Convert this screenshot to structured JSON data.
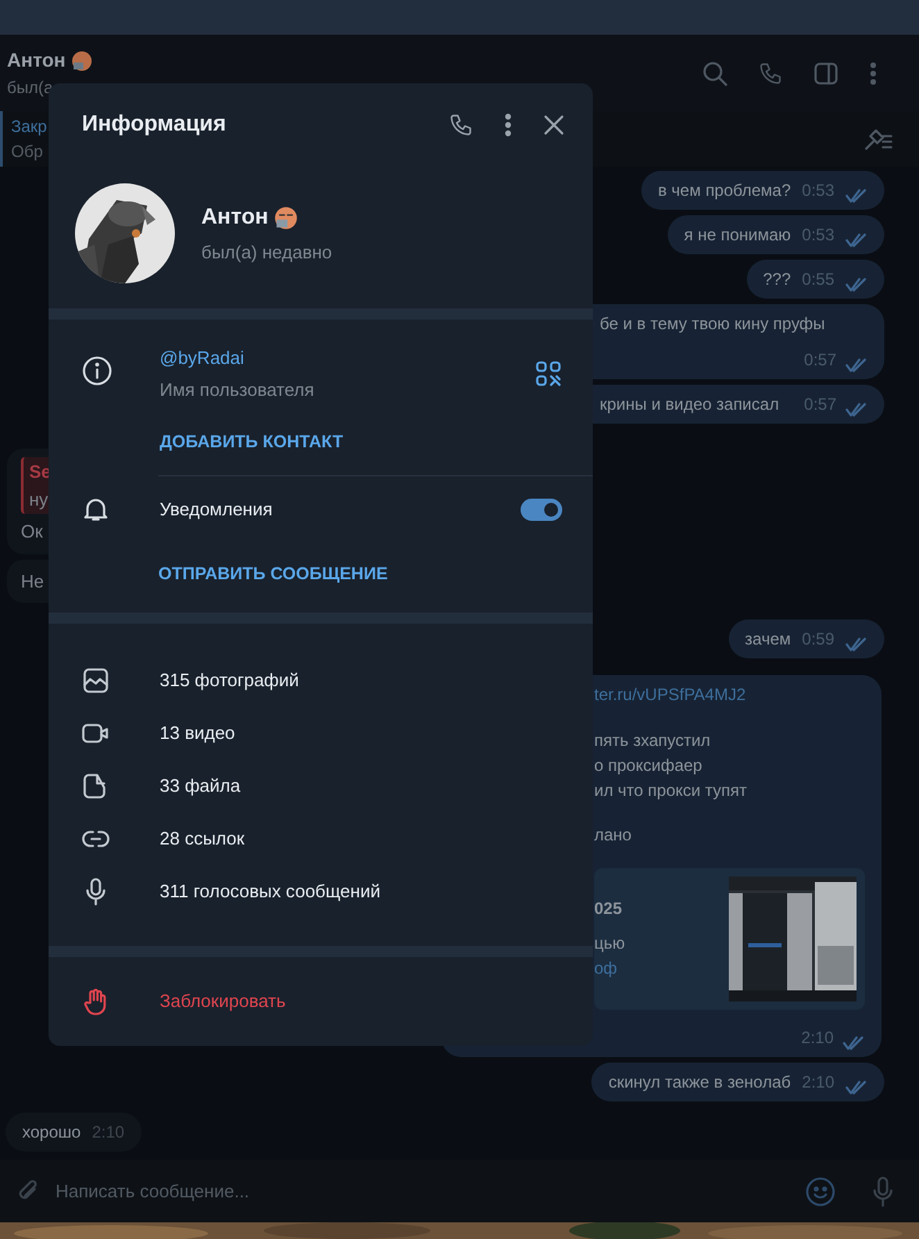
{
  "chat": {
    "title": "Антон",
    "status": "был(а",
    "pinned": {
      "title": "Закр",
      "text": "Обр"
    },
    "messages": [
      {
        "kind": "out",
        "text": "в чем проблема?",
        "time": "0:53",
        "read": true
      },
      {
        "kind": "out",
        "text": "я не понимаю",
        "time": "0:53",
        "read": true
      },
      {
        "kind": "out",
        "text": "???",
        "time": "0:55",
        "read": true
      },
      {
        "kind": "out_cut",
        "text": "бе и в тему твою кину пруфы",
        "time": "0:57",
        "read": true
      },
      {
        "kind": "out_cut",
        "text": "крины и видео записал",
        "time": "0:57",
        "read": true
      },
      {
        "kind": "in_cut",
        "quote": {
          "author": "Se",
          "text": "ну"
        },
        "text": "Ок"
      },
      {
        "kind": "in_cut",
        "text": "Не"
      },
      {
        "kind": "out",
        "text": "зачем",
        "time": "0:59",
        "read": true
      },
      {
        "kind": "out_rich",
        "link": "ter.ru/vUPSfPA4MJ2",
        "paragraphs": [
          [
            "пять зхапустил",
            "о проксифаер",
            "ил что прокси тупят"
          ],
          [
            "лано"
          ]
        ],
        "preview": {
          "title": "025",
          "text": "цью",
          "link": "оф",
          "kind": "picture"
        },
        "time": "2:10",
        "read": true
      },
      {
        "kind": "out",
        "text": "скинул также в зенолаб",
        "time": "2:10",
        "read": true
      },
      {
        "kind": "in",
        "text": "хорошо",
        "time": "2:10"
      }
    ],
    "input": {
      "placeholder": "Написать сообщение..."
    }
  },
  "info_panel": {
    "title": "Информация",
    "name": "Антон",
    "status": "был(а) недавно",
    "username": "@byRadai",
    "username_label": "Имя пользователя",
    "add_contact": "ДОБАВИТЬ КОНТАКТ",
    "notifications": {
      "label": "Уведомления",
      "on": true
    },
    "send_message": "ОТПРАВИТЬ СООБЩЕНИЕ",
    "media": [
      {
        "label": "315 фотографий"
      },
      {
        "kind": "video",
        "label": "13 видео"
      },
      {
        "kind": "file",
        "label": "33 файла"
      },
      {
        "kind": "link",
        "label": "28 ссылок"
      },
      {
        "kind": "voice",
        "label": "311 голосовых сообщений"
      }
    ],
    "block": "Заблокировать"
  }
}
